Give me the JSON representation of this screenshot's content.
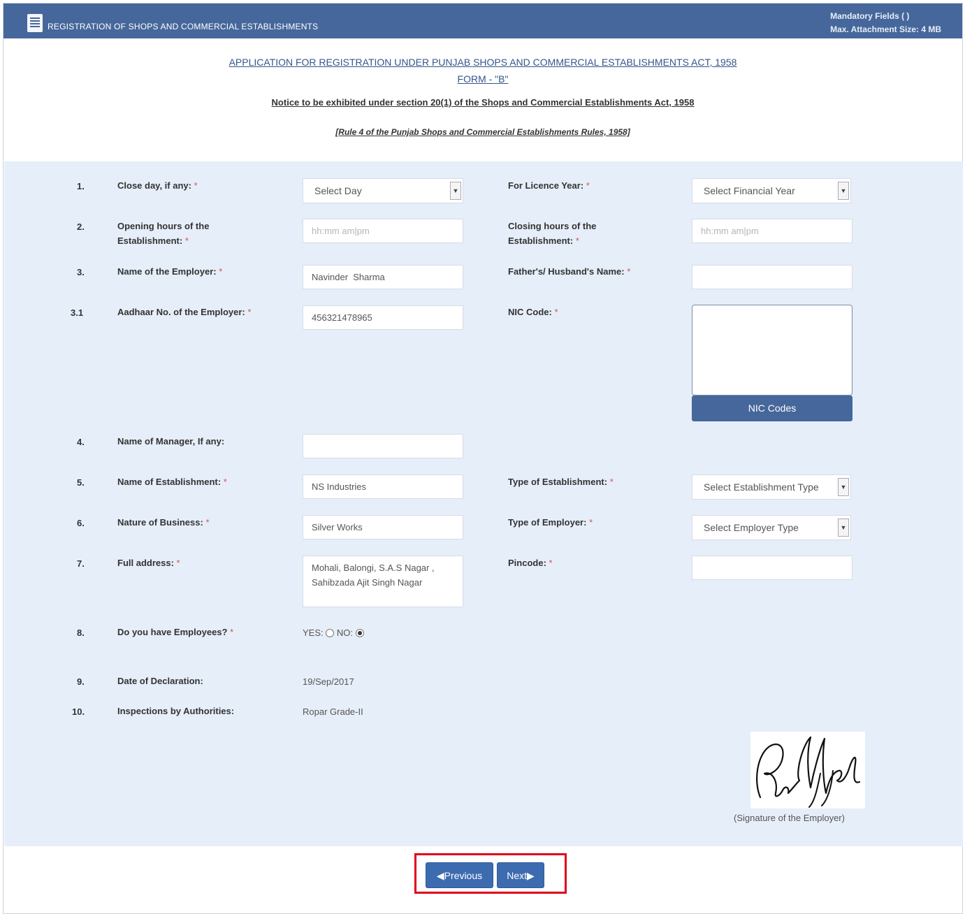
{
  "titlebar": {
    "title": "REGISTRATION OF SHOPS AND COMMERCIAL ESTABLISHMENTS",
    "mandatory": "Mandatory Fields (  )",
    "max_attachment": "Max. Attachment Size: 4 MB"
  },
  "header": {
    "line1": "APPLICATION FOR REGISTRATION UNDER PUNJAB SHOPS AND COMMERCIAL ESTABLISHMENTS ACT, 1958",
    "line2": "FORM - \"B\"",
    "line3": "Notice to be exhibited under section 20(1) of the Shops and Commercial Establishments Act, 1958",
    "line4": "[Rule 4 of the Punjab Shops and Commercial Establishments Rules, 1958]"
  },
  "form": {
    "close_day": {
      "num": "1.",
      "label": "Close day, if any:",
      "req": "*",
      "value": "Select Day"
    },
    "licence_year": {
      "label": "For Licence Year:",
      "req": "*",
      "value": "Select Financial Year"
    },
    "opening_hours": {
      "num": "2.",
      "label_a": "Opening hours of the",
      "label_b": "Establishment:",
      "req": "*",
      "placeholder": "hh:mm am|pm"
    },
    "closing_hours": {
      "label_a": "Closing hours of the",
      "label_b": "Establishment:",
      "req": "*",
      "placeholder": "hh:mm am|pm"
    },
    "employer_name": {
      "num": "3.",
      "label": "Name of the Employer:",
      "req": "*",
      "value": "Navinder  Sharma"
    },
    "father_name": {
      "label": "Father's/ Husband's Name:",
      "req": "*",
      "value": ""
    },
    "aadhaar": {
      "num": "3.1",
      "label": "Aadhaar No. of the Employer:",
      "req": "*",
      "value": "456321478965"
    },
    "nic_code": {
      "label": "NIC Code:",
      "req": "*",
      "button": "NIC Codes"
    },
    "manager": {
      "num": "4.",
      "label": "Name of Manager, If any:",
      "value": ""
    },
    "establishment_name": {
      "num": "5.",
      "label": "Name of Establishment:",
      "req": "*",
      "value": "NS Industries"
    },
    "establishment_type": {
      "label": "Type of Establishment:",
      "req": "*",
      "value": "Select Establishment Type"
    },
    "nature": {
      "num": "6.",
      "label": "Nature of Business:",
      "req": "*",
      "value": "Silver Works"
    },
    "employer_type": {
      "label": "Type of Employer:",
      "req": "*",
      "value": "Select Employer Type"
    },
    "address": {
      "num": "7.",
      "label": "Full address:",
      "req": "*",
      "value": "Mohali, Balongi, S.A.S Nagar , Sahibzada Ajit Singh Nagar"
    },
    "pincode": {
      "label": "Pincode:",
      "req": "*",
      "value": ""
    },
    "employees": {
      "num": "8.",
      "label": "Do you have Employees?",
      "req": "*",
      "yes": "YES:",
      "no": "NO:",
      "selected": "NO"
    },
    "declaration": {
      "num": "9.",
      "label": "Date of Declaration:",
      "value": "19/Sep/2017"
    },
    "inspections": {
      "num": "10.",
      "label": "Inspections by Authorities:",
      "value": "Ropar Grade-II"
    },
    "signature_caption": "(Signature of the Employer)"
  },
  "nav": {
    "previous": "Previous",
    "next": "Next"
  },
  "colors": {
    "titlebar": "#46679b",
    "panel": "#e6eef9",
    "button": "#3d6bb0",
    "highlight": "#e0001b"
  }
}
